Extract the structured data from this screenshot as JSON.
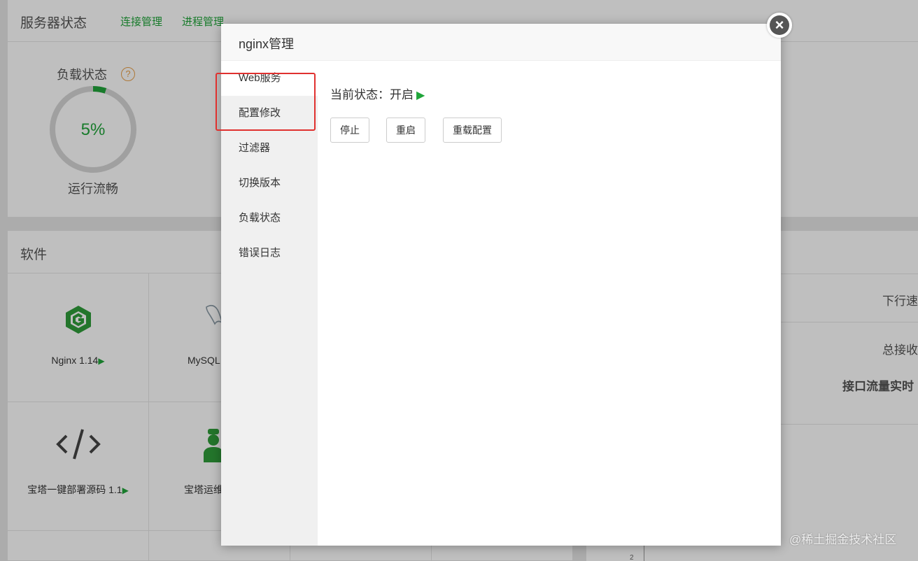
{
  "background": {
    "status_panel": {
      "title": "服务器状态",
      "links": [
        "连接管理",
        "进程管理"
      ],
      "load_label": "负载状态",
      "help": "?",
      "load_percent": "5%",
      "load_value": 5,
      "run_status": "运行流畅"
    },
    "software_panel": {
      "title": "软件",
      "items": [
        {
          "label": "Nginx 1.14",
          "play": "▶",
          "icon": "nginx-icon"
        },
        {
          "label": "MySQL",
          "play": "",
          "icon": "mysql-icon"
        },
        {
          "label": "宝塔一键部署源码 1.1",
          "play": "▶",
          "icon": "code-icon"
        },
        {
          "label": "宝塔运维",
          "play": "",
          "icon": "operator-icon"
        }
      ]
    },
    "net_panel": {
      "down_speed": "下行速",
      "total_recv": "总接收",
      "realtime": "接口流量实时"
    },
    "chart_tick": "2"
  },
  "modal": {
    "title": "nginx管理",
    "close": "×",
    "menu": [
      "Web服务",
      "配置修改",
      "过滤器",
      "切换版本",
      "负载状态",
      "错误日志"
    ],
    "active_index": 0,
    "status_label": "当前状态：开启",
    "status_icon": "▶",
    "buttons": {
      "stop": "停止",
      "restart": "重启",
      "reload": "重载配置"
    }
  },
  "watermark": "@稀土掘金技术社区",
  "colors": {
    "accent": "#20a53a",
    "highlight": "#e0312f"
  }
}
